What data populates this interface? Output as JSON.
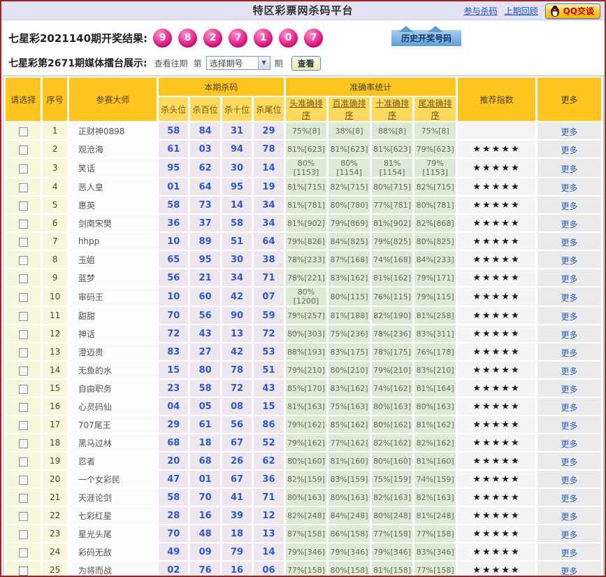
{
  "header": {
    "title": "特区彩票网杀码平台",
    "links": [
      {
        "label": "参与杀码"
      },
      {
        "label": "上期回顾"
      }
    ],
    "qq_label": "QQ交谈"
  },
  "draw": {
    "label": "七星彩2021140期开奖结果:",
    "balls": [
      "9",
      "8",
      "2",
      "7",
      "1",
      "0",
      "7"
    ],
    "history_button": "历史开奖号码"
  },
  "arena": {
    "label": "七星彩第2671期媒体擂台展示:",
    "view_past": "查看往期",
    "di": "第",
    "select_placeholder": "选择期号",
    "qi": "期",
    "view_button": "查看"
  },
  "table": {
    "headers": {
      "select": "请选择",
      "index": "序号",
      "master": "参赛大师",
      "kill_group": "本期杀码",
      "kill_subs": [
        "杀头位",
        "杀百位",
        "杀十位",
        "杀尾位"
      ],
      "accuracy_group": "准确率统计",
      "accuracy_subs": [
        "头准确排序",
        "百准确排序",
        "十准确排序",
        "尾准确排序"
      ],
      "stars": "推荐指数",
      "more": "更多"
    },
    "row_more_label": "更多",
    "star_full": "★★★★★",
    "rows": [
      {
        "no": "1",
        "name": "正财神0898",
        "kills": [
          "58",
          "84",
          "31",
          "29"
        ],
        "acc": [
          "75%[8]",
          "38%[8]",
          "88%[8]",
          "75%[8]"
        ],
        "stars": false
      },
      {
        "no": "2",
        "name": "观沧海",
        "kills": [
          "61",
          "03",
          "94",
          "78"
        ],
        "acc": [
          "81%[623]",
          "81%[623]",
          "81%[623]",
          "79%[623]"
        ],
        "stars": true
      },
      {
        "no": "3",
        "name": "笑话",
        "kills": [
          "95",
          "62",
          "30",
          "14"
        ],
        "acc": [
          "80%[1153]",
          "80%[1154]",
          "81%[1154]",
          "79%[1153]"
        ],
        "stars": true
      },
      {
        "no": "4",
        "name": "恶人皇",
        "kills": [
          "01",
          "64",
          "95",
          "19"
        ],
        "acc": [
          "81%[715]",
          "82%[715]",
          "80%[715]",
          "82%[715]"
        ],
        "stars": true
      },
      {
        "no": "5",
        "name": "惠英",
        "kills": [
          "58",
          "73",
          "14",
          "34"
        ],
        "acc": [
          "81%[781]",
          "80%[780]",
          "77%[781]",
          "80%[781]"
        ],
        "stars": true
      },
      {
        "no": "6",
        "name": "剑南宋樊",
        "kills": [
          "36",
          "37",
          "58",
          "34"
        ],
        "acc": [
          "81%[902]",
          "79%[869]",
          "81%[902]",
          "82%[868]"
        ],
        "stars": true
      },
      {
        "no": "7",
        "name": "hhpp",
        "kills": [
          "10",
          "89",
          "51",
          "64"
        ],
        "acc": [
          "79%[826]",
          "84%[825]",
          "79%[825]",
          "80%[825]"
        ],
        "stars": true
      },
      {
        "no": "8",
        "name": "玉姐",
        "kills": [
          "65",
          "95",
          "30",
          "38"
        ],
        "acc": [
          "78%[233]",
          "87%[168]",
          "74%[168]",
          "84%[233]"
        ],
        "stars": true
      },
      {
        "no": "9",
        "name": "蓝梦",
        "kills": [
          "56",
          "21",
          "34",
          "71"
        ],
        "acc": [
          "78%[221]",
          "83%[162]",
          "81%[162]",
          "79%[171]"
        ],
        "stars": true
      },
      {
        "no": "10",
        "name": "审码王",
        "kills": [
          "10",
          "60",
          "42",
          "07"
        ],
        "acc": [
          "80%[1200]",
          "80%[115]",
          "76%[115]",
          "79%[115]"
        ],
        "stars": true
      },
      {
        "no": "11",
        "name": "甜甜",
        "kills": [
          "70",
          "56",
          "90",
          "59"
        ],
        "acc": [
          "79%[257]",
          "81%[188]",
          "82%[190]",
          "81%[258]"
        ],
        "stars": true
      },
      {
        "no": "12",
        "name": "神话",
        "kills": [
          "72",
          "43",
          "13",
          "72"
        ],
        "acc": [
          "80%[303]",
          "75%[236]",
          "78%[236]",
          "83%[311]"
        ],
        "stars": true
      },
      {
        "no": "13",
        "name": "澄迈贵",
        "kills": [
          "83",
          "27",
          "42",
          "53"
        ],
        "acc": [
          "88%[193]",
          "83%[175]",
          "78%[175]",
          "76%[178]"
        ],
        "stars": true
      },
      {
        "no": "14",
        "name": "无鱼的水",
        "kills": [
          "15",
          "80",
          "78",
          "51"
        ],
        "acc": [
          "79%[210]",
          "80%[210]",
          "79%[210]",
          "83%[210]"
        ],
        "stars": true
      },
      {
        "no": "15",
        "name": "自由职务",
        "kills": [
          "23",
          "58",
          "72",
          "43"
        ],
        "acc": [
          "85%[170]",
          "83%[162]",
          "74%[162]",
          "81%[164]"
        ],
        "stars": true
      },
      {
        "no": "16",
        "name": "心灵码仙",
        "kills": [
          "04",
          "05",
          "08",
          "15"
        ],
        "acc": [
          "81%[163]",
          "75%[163]",
          "80%[163]",
          "80%[163]"
        ],
        "stars": true
      },
      {
        "no": "17",
        "name": "707尾王",
        "kills": [
          "29",
          "61",
          "56",
          "86"
        ],
        "acc": [
          "79%[162]",
          "85%[162]",
          "80%[162]",
          "81%[162]"
        ],
        "stars": true
      },
      {
        "no": "18",
        "name": "黑马过林",
        "kills": [
          "68",
          "18",
          "67",
          "52"
        ],
        "acc": [
          "79%[162]",
          "77%[162]",
          "82%[162]",
          "82%[162]"
        ],
        "stars": true
      },
      {
        "no": "19",
        "name": "忍者",
        "kills": [
          "20",
          "68",
          "26",
          "62"
        ],
        "acc": [
          "80%[160]",
          "81%[160]",
          "80%[160]",
          "81%[160]"
        ],
        "stars": true
      },
      {
        "no": "20",
        "name": "一个女彩民",
        "kills": [
          "47",
          "01",
          "67",
          "36"
        ],
        "acc": [
          "82%[159]",
          "83%[159]",
          "75%[159]",
          "74%[159]"
        ],
        "stars": true
      },
      {
        "no": "21",
        "name": "天涯论剑",
        "kills": [
          "58",
          "70",
          "41",
          "71"
        ],
        "acc": [
          "80%[163]",
          "80%[163]",
          "82%[163]",
          "82%[163]"
        ],
        "stars": true
      },
      {
        "no": "22",
        "name": "七彩红星",
        "kills": [
          "28",
          "16",
          "39",
          "12"
        ],
        "acc": [
          "82%[248]",
          "84%[248]",
          "80%[248]",
          "81%[248]"
        ],
        "stars": true
      },
      {
        "no": "23",
        "name": "星光头尾",
        "kills": [
          "70",
          "48",
          "18",
          "13"
        ],
        "acc": [
          "87%[158]",
          "86%[158]",
          "77%[158]",
          "77%[158]"
        ],
        "stars": true
      },
      {
        "no": "24",
        "name": "彩码无敌",
        "kills": [
          "49",
          "09",
          "79",
          "14"
        ],
        "acc": [
          "79%[346]",
          "79%[346]",
          "79%[346]",
          "83%[346]"
        ],
        "stars": true
      },
      {
        "no": "25",
        "name": "为将而战",
        "kills": [
          "02",
          "76",
          "16",
          "06"
        ],
        "acc": [
          "77%[158]",
          "80%[158]",
          "81%[158]",
          "77%[158]"
        ],
        "stars": true
      }
    ]
  },
  "colors": {
    "page_border": "#9b2424",
    "titlebar_bg": "#e2e2f2",
    "header_gold": "#ffc41e",
    "subheader_gold": "#ffd95e",
    "ball_pink": "#e8258f",
    "kill_number_blue": "#2b5acf",
    "kill_cell_bg": "#eee6ed",
    "accuracy_cell_bg": "#dbead5",
    "cream_cell_bg": "#f7f7dc",
    "link_blue": "#2e5fbf",
    "qq_text_red": "#c00000"
  }
}
